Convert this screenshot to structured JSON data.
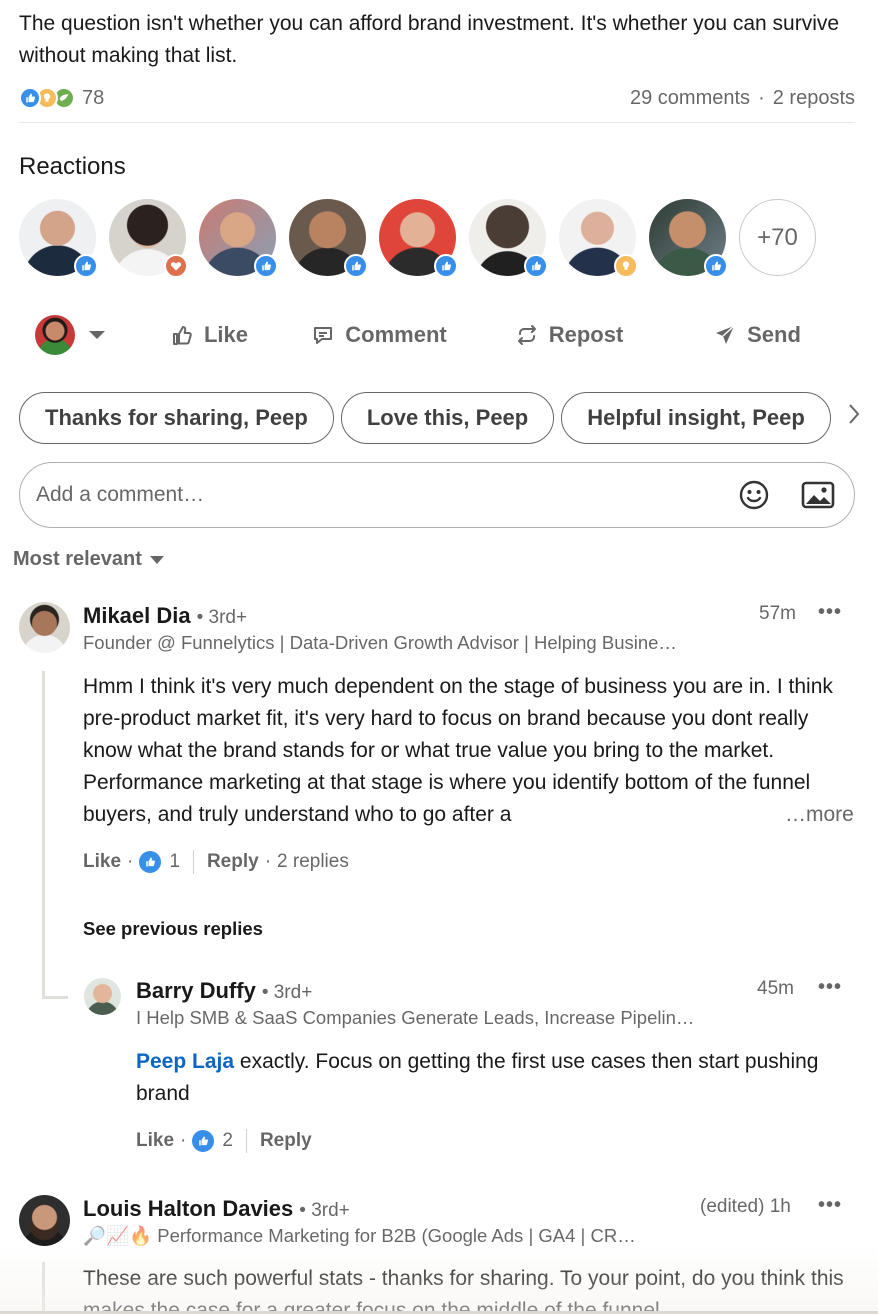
{
  "post": {
    "text": "The question isn't whether you can afford brand investment. It's whether you can survive without making that list."
  },
  "social_counts": {
    "reactions": "78",
    "comments": "29 comments",
    "separator": "·",
    "reposts": "2 reposts"
  },
  "reactions_section": {
    "title": "Reactions",
    "more_count": "+70",
    "reactor_badges": [
      "like",
      "love",
      "like",
      "like",
      "like",
      "like",
      "insight",
      "like"
    ]
  },
  "actions": {
    "like": "Like",
    "comment": "Comment",
    "repost": "Repost",
    "send": "Send"
  },
  "quick_replies": [
    "Thanks for sharing, Peep",
    "Love this, Peep",
    "Helpful insight, Peep"
  ],
  "comment_box": {
    "placeholder": "Add a comment…"
  },
  "sort": {
    "label": "Most relevant"
  },
  "comments": [
    {
      "name": "Mikael Dia",
      "degree": "• 3rd+",
      "headline": "Founder @ Funnelytics | Data-Driven Growth Advisor | Helping Busine…",
      "time": "57m",
      "menu": "•••",
      "body": "Hmm I think it's very much dependent on the stage of business you are in. I think pre-product market fit, it's very hard to focus on brand because you dont really know what the brand stands for or what true value you bring to the market. Performance marketing at that stage is where you identify bottom of the funnel buyers, and truly understand who to go after a",
      "more": "…more",
      "like_label": "Like",
      "like_count": "1",
      "reply_label": "Reply",
      "replies": "2 replies"
    },
    {
      "name": "Barry Duffy",
      "degree": "• 3rd+",
      "headline": "I Help SMB & SaaS Companies Generate Leads, Increase Pipelin…",
      "time": "45m",
      "menu": "•••",
      "mention": "Peep Laja",
      "body": " exactly. Focus on getting the first use cases then start pushing brand",
      "like_label": "Like",
      "like_count": "2",
      "reply_label": "Reply"
    },
    {
      "name": "Louis Halton Davies",
      "degree": "• 3rd+",
      "headline": "🔎📈🔥 Performance Marketing for B2B (Google Ads | GA4 | CR…",
      "time": "(edited) 1h",
      "menu": "•••",
      "body": "These are such powerful stats - thanks for sharing. To your point, do you think this makes the case for a greater focus on the middle of the funnel"
    }
  ],
  "see_previous": "See previous replies",
  "colors": {
    "link_blue": "#0a66c2",
    "like_blue": "#378fe9",
    "love_orange": "#df704d",
    "insight_yellow": "#f5bb5c",
    "support_green": "#6dae4f",
    "secondary_text": "#666666"
  },
  "icons": {
    "like": "thumbs-up-icon",
    "comment": "speech-bubble-icon",
    "repost": "repost-arrows-icon",
    "send": "paper-plane-icon",
    "emoji": "smiley-icon",
    "photo": "image-icon",
    "next": "chevron-right-icon"
  }
}
